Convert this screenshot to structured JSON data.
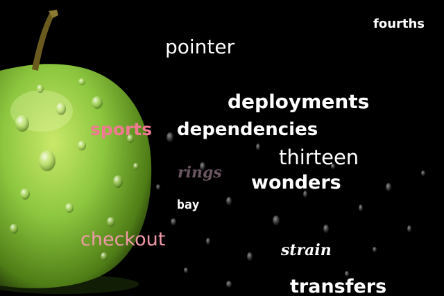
{
  "image": {
    "subject": "green-apple",
    "background_color": "#000000",
    "apple_color": "#8cc63f"
  },
  "words": [
    {
      "id": "fourths",
      "text": "fourths",
      "color": "#ffffff"
    },
    {
      "id": "pointer",
      "text": "pointer",
      "color": "#ffffff"
    },
    {
      "id": "deployments",
      "text": "deployments",
      "color": "#ffffff"
    },
    {
      "id": "sports",
      "text": "sports",
      "color": "#f07a92"
    },
    {
      "id": "dependencies",
      "text": "dependencies",
      "color": "#ffffff"
    },
    {
      "id": "thirteen",
      "text": "thirteen",
      "color": "#ffffff"
    },
    {
      "id": "rings",
      "text": "rings",
      "color": "#6a5660"
    },
    {
      "id": "wonders",
      "text": "wonders",
      "color": "#ffffff"
    },
    {
      "id": "bay",
      "text": "bay",
      "color": "#ffffff"
    },
    {
      "id": "checkout",
      "text": "checkout",
      "color": "#f29aaa"
    },
    {
      "id": "strain",
      "text": "strain",
      "color": "#ffffff"
    },
    {
      "id": "transfers",
      "text": "transfers",
      "color": "#ffffff"
    }
  ]
}
